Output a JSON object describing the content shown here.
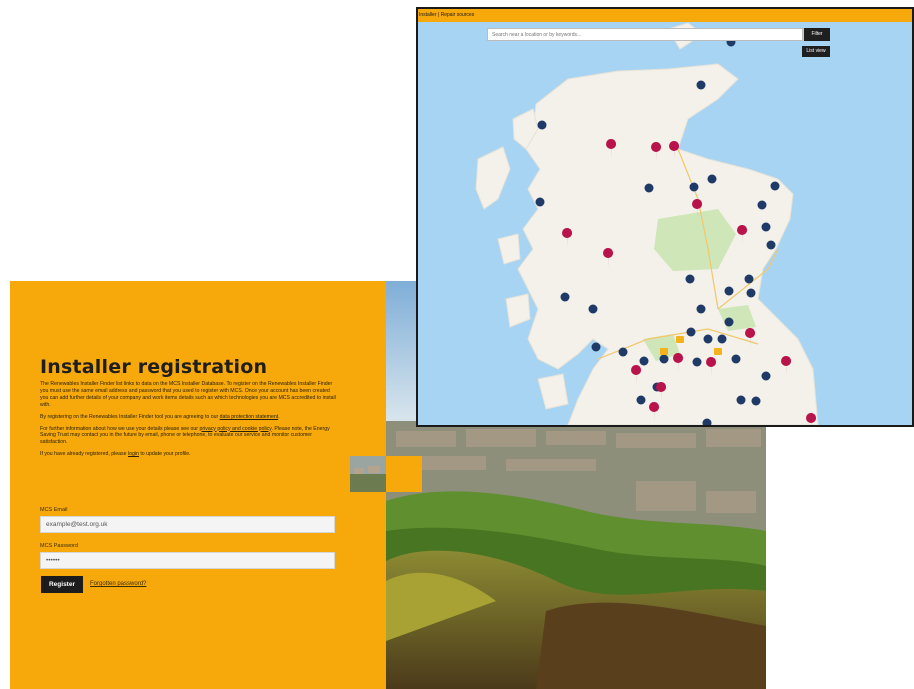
{
  "registration": {
    "title": "Installer registration",
    "para1": "The Renewables Installer Finder list links to data on the MCS Installer Database. To register on the Renewables Installer Finder you must use the same email address and password that you used to register with MCS. Once your account has been created you can add further details of your company and work items details such as which technologies you are MCS accredited to install with.",
    "para2_pre": "By registering on the Renewables Installer Finder tool you are agreeing to our ",
    "para2_link": "data protection statement",
    "para2_post": ".",
    "para3_pre": "For further information about how we use your details please see our ",
    "para3_link": "privacy policy and cookie policy",
    "para3_post": ". Please note, the Energy Saving Trust may contact you in the future by email, phone or telephone, to evaluate our service and monitor customer satisfaction.",
    "para4_pre": "If you have already registered, please ",
    "para4_link": "login",
    "para4_post": " to update your profile.",
    "email_label": "MCS Email",
    "email_value": "example@test.org.uk",
    "password_label": "MCS Password",
    "password_value": "••••••",
    "register_button": "Register",
    "forgot_link": "Forgotten password?"
  },
  "map": {
    "topbar_text": "Installer | Repair sources",
    "search_placeholder": "Search near a location or by keywords...",
    "filter_button": "Filter",
    "list_view_button": "List view"
  },
  "colors": {
    "brand_orange": "#f7a90c",
    "pin_red": "#b8134a",
    "pin_navy": "#1f3a66",
    "pin_yellow": "#f4b21c",
    "sea": "#a8d4f4",
    "land": "#f3f1ea",
    "park": "#cfe6b8"
  },
  "icons": {
    "red_pin": "map-marker-red-icon",
    "cluster_pin": "map-cluster-icon",
    "yellow_pin": "map-marker-yellow-icon"
  }
}
